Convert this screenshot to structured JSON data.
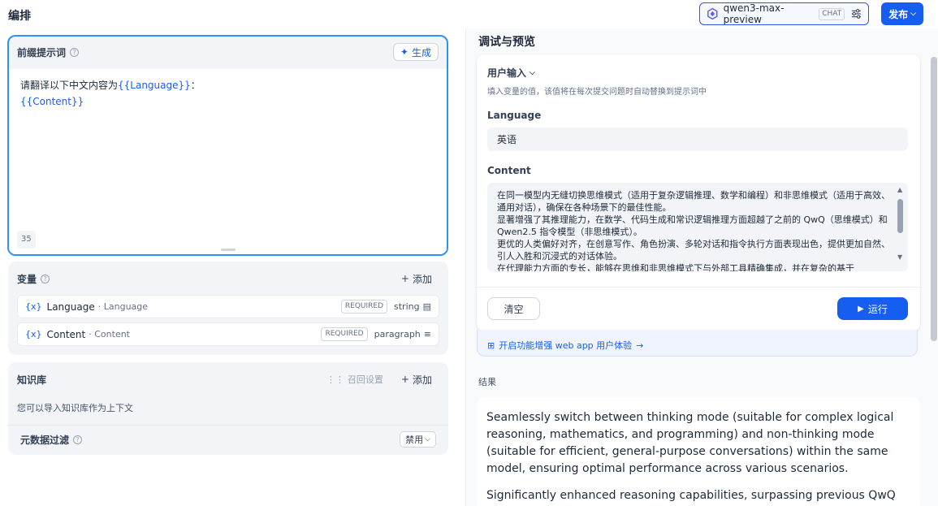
{
  "header": {
    "title": "编排",
    "model_name": "qwen3-max-preview",
    "model_badge": "CHAT",
    "publish_label": "发布"
  },
  "prompt": {
    "title": "前缀提示词",
    "generate_label": "生成",
    "line1_text": "请翻译以下中文内容为",
    "line1_var": "{{Language}}",
    "line1_suffix": "：",
    "line2_var": "{{Content}}",
    "char_count": "35"
  },
  "variables": {
    "title": "变量",
    "add_label": "添加",
    "items": [
      {
        "icon": "{x}",
        "name": "Language",
        "label": "· Language",
        "badge": "REQUIRED",
        "type": "string"
      },
      {
        "icon": "{x}",
        "name": "Content",
        "label": "· Content",
        "badge": "REQUIRED",
        "type": "paragraph"
      }
    ]
  },
  "knowledge": {
    "title": "知识库",
    "recall_label": "召回设置",
    "add_label": "添加",
    "description": "您可以导入知识库作为上下文",
    "metadata_title": "元数据过滤",
    "metadata_value": "禁用"
  },
  "debug": {
    "title": "调试与预览",
    "user_input_title": "用户输入",
    "user_input_hint": "填入变量的值，该值将在每次提交问题时自动替换到提示词中",
    "language_label": "Language",
    "language_value": "英语",
    "content_label": "Content",
    "content_lines": [
      "在同一模型内无缝切换思维模式（适用于复杂逻辑推理、数学和编程）和非思维模式（适用于高效、通用对话），确保在各种场景下的最佳性能。",
      "显著增强了其推理能力，在数学、代码生成和常识逻辑推理方面超越了之前的 QwQ（思维模式）和 Qwen2.5 指令模型（非思维模式）。",
      "更优的人类偏好对齐，在创意写作、角色扮演、多轮对话和指令执行方面表现出色，提供更加自然、引人入胜和沉浸式的对话体验。",
      "在代理能力方面的专长，能够在思维和非思维模式下与外部工具精确集成，并在复杂的基于"
    ],
    "clear_label": "清空",
    "run_label": "运行",
    "webapp_label": "开启功能增强 web app 用户体验",
    "result_label": "结果",
    "result_paragraphs": [
      "Seamlessly switch between thinking mode (suitable for complex logical reasoning, mathematics, and programming) and non-thinking mode (suitable for efficient, general-purpose conversations) within the same model, ensuring optimal performance across various scenarios.",
      "Significantly enhanced reasoning capabilities, surpassing previous QwQ"
    ]
  },
  "colors": {
    "accent": "#155eef",
    "focus_border": "#2e90fa",
    "panel_bg": "#f2f4f7"
  }
}
